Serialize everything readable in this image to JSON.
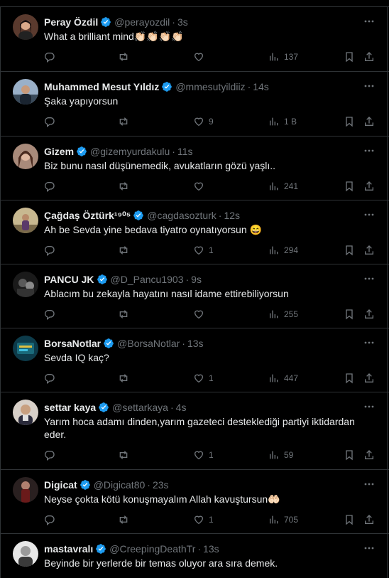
{
  "feed": {
    "tweets": [
      {
        "name": "Peray Özdil",
        "handle": "@perayozdil",
        "time": "3s",
        "text": "What a brilliant mind👏🏻👏🏻👏🏻👏🏻",
        "reply_count": "",
        "retweet_count": "",
        "like_count": "",
        "view_count": "137",
        "avatar_color": "#5a3a2e"
      },
      {
        "name": "Muhammed Mesut Yıldız",
        "handle": "@mmesutyildiiz",
        "time": "14s",
        "text": "Şaka yapıyorsun",
        "reply_count": "",
        "retweet_count": "",
        "like_count": "9",
        "view_count": "1 B",
        "avatar_color": "#3a4a5a"
      },
      {
        "name": "Gizem",
        "handle": "@gizemyurdakulu",
        "time": "11s",
        "text": "Biz bunu nasıl düşünemedik, avukatların gözü yaşlı..",
        "reply_count": "",
        "retweet_count": "",
        "like_count": "",
        "view_count": "241",
        "avatar_color": "#6b4a3a"
      },
      {
        "name": "Çağdaş Öztürk¹⁹⁰⁵",
        "handle": "@cagdasozturk",
        "time": "12s",
        "text": "Ah be Sevda yine bedava tiyatro oynatıyorsun 😄",
        "reply_count": "",
        "retweet_count": "",
        "like_count": "1",
        "view_count": "294",
        "avatar_color": "#7a6a4a"
      },
      {
        "name": "PANCU JK",
        "handle": "@D_Pancu1903",
        "time": "9s",
        "text": "Ablacım bu zekayla hayatını nasıl idame ettirebiliyorsun",
        "reply_count": "",
        "retweet_count": "",
        "like_count": "",
        "view_count": "255",
        "avatar_color": "#2a2a2a"
      },
      {
        "name": "BorsaNotlar",
        "handle": "@BorsaNotlar",
        "time": "13s",
        "text": "Sevda IQ kaç?",
        "reply_count": "",
        "retweet_count": "",
        "like_count": "1",
        "view_count": "447",
        "avatar_color": "#0d3b4a"
      },
      {
        "name": "settar kaya",
        "handle": "@settarkaya",
        "time": "4s",
        "text": "Yarım hoca adamı dinden,yarım gazeteci desteklediği partiyi iktidardan eder.",
        "reply_count": "",
        "retweet_count": "",
        "like_count": "1",
        "view_count": "59",
        "avatar_color": "#8a7a6a"
      },
      {
        "name": "Digicat",
        "handle": "@Digicat80",
        "time": "23s",
        "text": "Neyse çokta kötü konuşmayalım Allah kavuştursun🤲🏻",
        "reply_count": "",
        "retweet_count": "",
        "like_count": "1",
        "view_count": "705",
        "avatar_color": "#3a2a2a"
      },
      {
        "name": "mastavralı",
        "handle": "@CreepingDeathTr",
        "time": "13s",
        "text": "Beyinde bir yerlerde bir temas oluyor ara sıra demek.",
        "reply_count": "",
        "retweet_count": "",
        "like_count": "",
        "view_count": "",
        "avatar_color": "#cfcfcf"
      }
    ]
  },
  "colors": {
    "background": "#000000",
    "text": "#e7e9ea",
    "muted": "#71767b",
    "border": "#2f3336",
    "verified": "#1d9bf0"
  },
  "icons": {
    "reply": "reply-icon",
    "retweet": "retweet-icon",
    "like": "heart-icon",
    "views": "views-icon",
    "bookmark": "bookmark-icon",
    "share": "share-icon",
    "more": "more-icon",
    "verified": "verified-badge-icon"
  }
}
